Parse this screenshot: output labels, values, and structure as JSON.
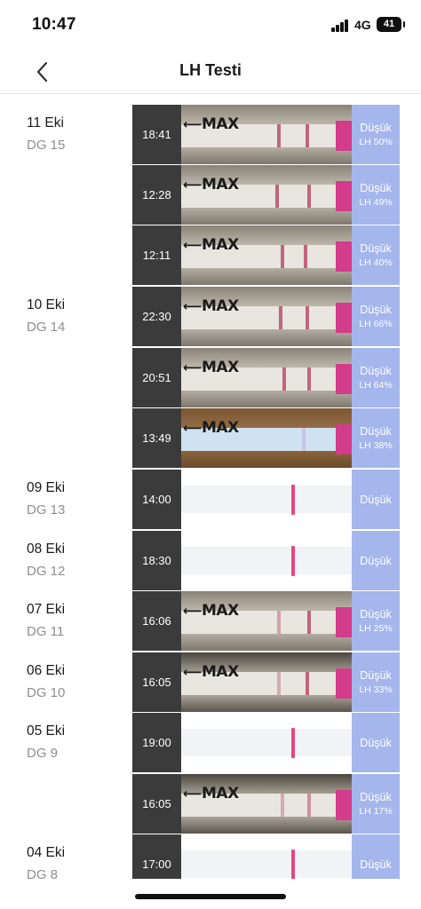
{
  "status_bar": {
    "time": "10:47",
    "network": "4G",
    "battery": "41"
  },
  "nav": {
    "title": "LH Testi"
  },
  "strip_text": {
    "max": "MAX"
  },
  "groups": [
    {
      "date": "11 Eki",
      "dg": "DG 15"
    },
    {
      "date": "10 Eki",
      "dg": "DG 14"
    },
    {
      "date": "09 Eki",
      "dg": "DG 13"
    },
    {
      "date": "08 Eki",
      "dg": "DG 12"
    },
    {
      "date": "07 Eki",
      "dg": "DG 11"
    },
    {
      "date": "06 Eki",
      "dg": "DG 10"
    },
    {
      "date": "05 Eki",
      "dg": "DG 9"
    },
    {
      "date": "04 Eki",
      "dg": "DG 8"
    }
  ],
  "entries": [
    {
      "time": "18:41",
      "result": "Düşük",
      "lh": "LH 50%"
    },
    {
      "time": "12:28",
      "result": "Düşük",
      "lh": "LH 49%"
    },
    {
      "time": "12:11",
      "result": "Düşük",
      "lh": "LH 40%"
    },
    {
      "time": "22:30",
      "result": "Düşük",
      "lh": "LH 66%"
    },
    {
      "time": "20:51",
      "result": "Düşük",
      "lh": "LH 64%"
    },
    {
      "time": "13:49",
      "result": "Düşük",
      "lh": "LH 38%"
    },
    {
      "time": "14:00",
      "result": "Düşük",
      "lh": ""
    },
    {
      "time": "18:30",
      "result": "Düşük",
      "lh": ""
    },
    {
      "time": "16:06",
      "result": "Düşük",
      "lh": "LH 25%"
    },
    {
      "time": "16:05",
      "result": "Düşük",
      "lh": "LH 33%"
    },
    {
      "time": "19:00",
      "result": "Düşük",
      "lh": ""
    },
    {
      "time": "16:05",
      "result": "Düşük",
      "lh": "LH 17%"
    },
    {
      "time": "17:00",
      "result": "Düşük",
      "lh": ""
    }
  ],
  "colors": {
    "result_bg": "#a4b6ec",
    "time_bg": "#3b3b3b",
    "test_line": "#e5477f"
  }
}
